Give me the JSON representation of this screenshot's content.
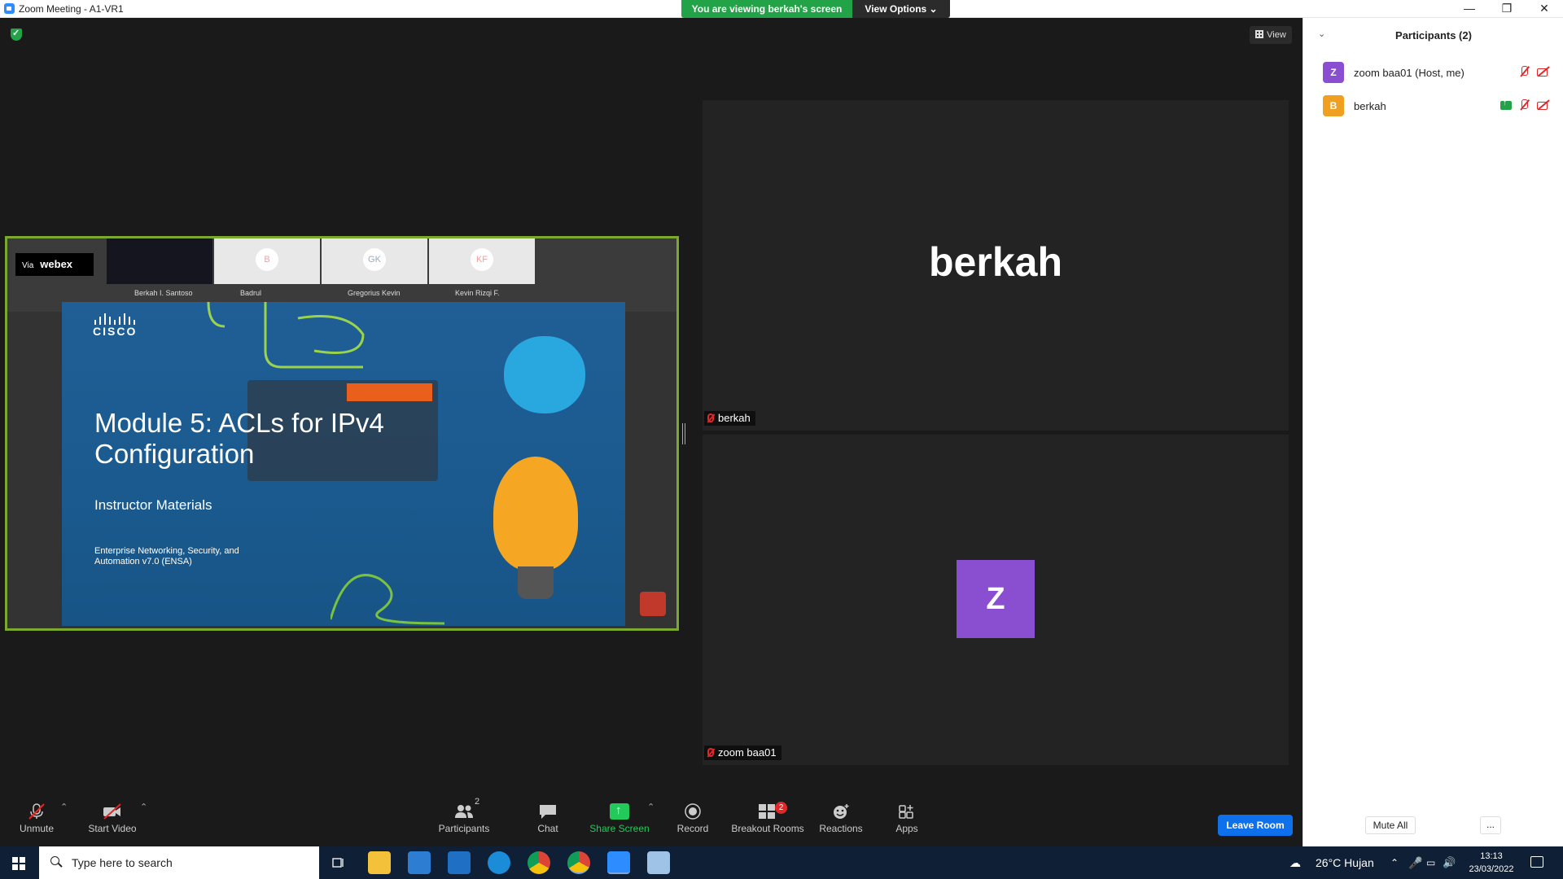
{
  "window": {
    "title": "Zoom Meeting - A1-VR1",
    "min": "—",
    "max": "❐",
    "close": "✕"
  },
  "banner": {
    "viewing": "You are viewing berkah's screen",
    "view_options": "View Options ⌄"
  },
  "topbar": {
    "view_label": "View"
  },
  "shared_screen": {
    "webex_via": "Via",
    "webex_brand": "webex",
    "thumbnails": [
      {
        "label": "Berkah I. Santoso",
        "initials": ""
      },
      {
        "label": "Badrul",
        "initials": "B"
      },
      {
        "label": "Gregorius Kevin",
        "initials": "GK"
      },
      {
        "label": "Kevin Rizqi F.",
        "initials": "KF"
      }
    ],
    "slide": {
      "brand": "CISCO",
      "title": "Module 5: ACLs for IPv4 Configuration",
      "subtitle": "Instructor Materials",
      "footer": "Enterprise Networking, Security, and Automation v7.0 (ENSA)"
    }
  },
  "tiles": [
    {
      "big_name": "berkah",
      "label": "berkah"
    },
    {
      "avatar": "Z",
      "label": "zoom baa01"
    }
  ],
  "toolbar": {
    "unmute": "Unmute",
    "start_video": "Start Video",
    "participants": "Participants",
    "participants_count": "2",
    "chat": "Chat",
    "share_screen": "Share Screen",
    "record": "Record",
    "breakout_rooms": "Breakout Rooms",
    "breakout_count": "2",
    "reactions": "Reactions",
    "apps": "Apps",
    "leave_room": "Leave Room",
    "caret": "⌃"
  },
  "participants_panel": {
    "title": "Participants (2)",
    "collapse": "⌄",
    "people": [
      {
        "initial": "Z",
        "name": "zoom baa01 (Host, me)",
        "color": "#8a4fd0"
      },
      {
        "initial": "B",
        "name": "berkah",
        "color": "#f0a020"
      }
    ],
    "mute_all": "Mute All",
    "more": "..."
  },
  "taskbar": {
    "search_placeholder": "Type here to search",
    "weather": "26°C  Hujan",
    "time": "13:13",
    "date": "23/03/2022"
  },
  "colors": {
    "share_border": "#7ba82e",
    "accent_green": "#23a347",
    "leave_blue": "#0e71eb"
  }
}
